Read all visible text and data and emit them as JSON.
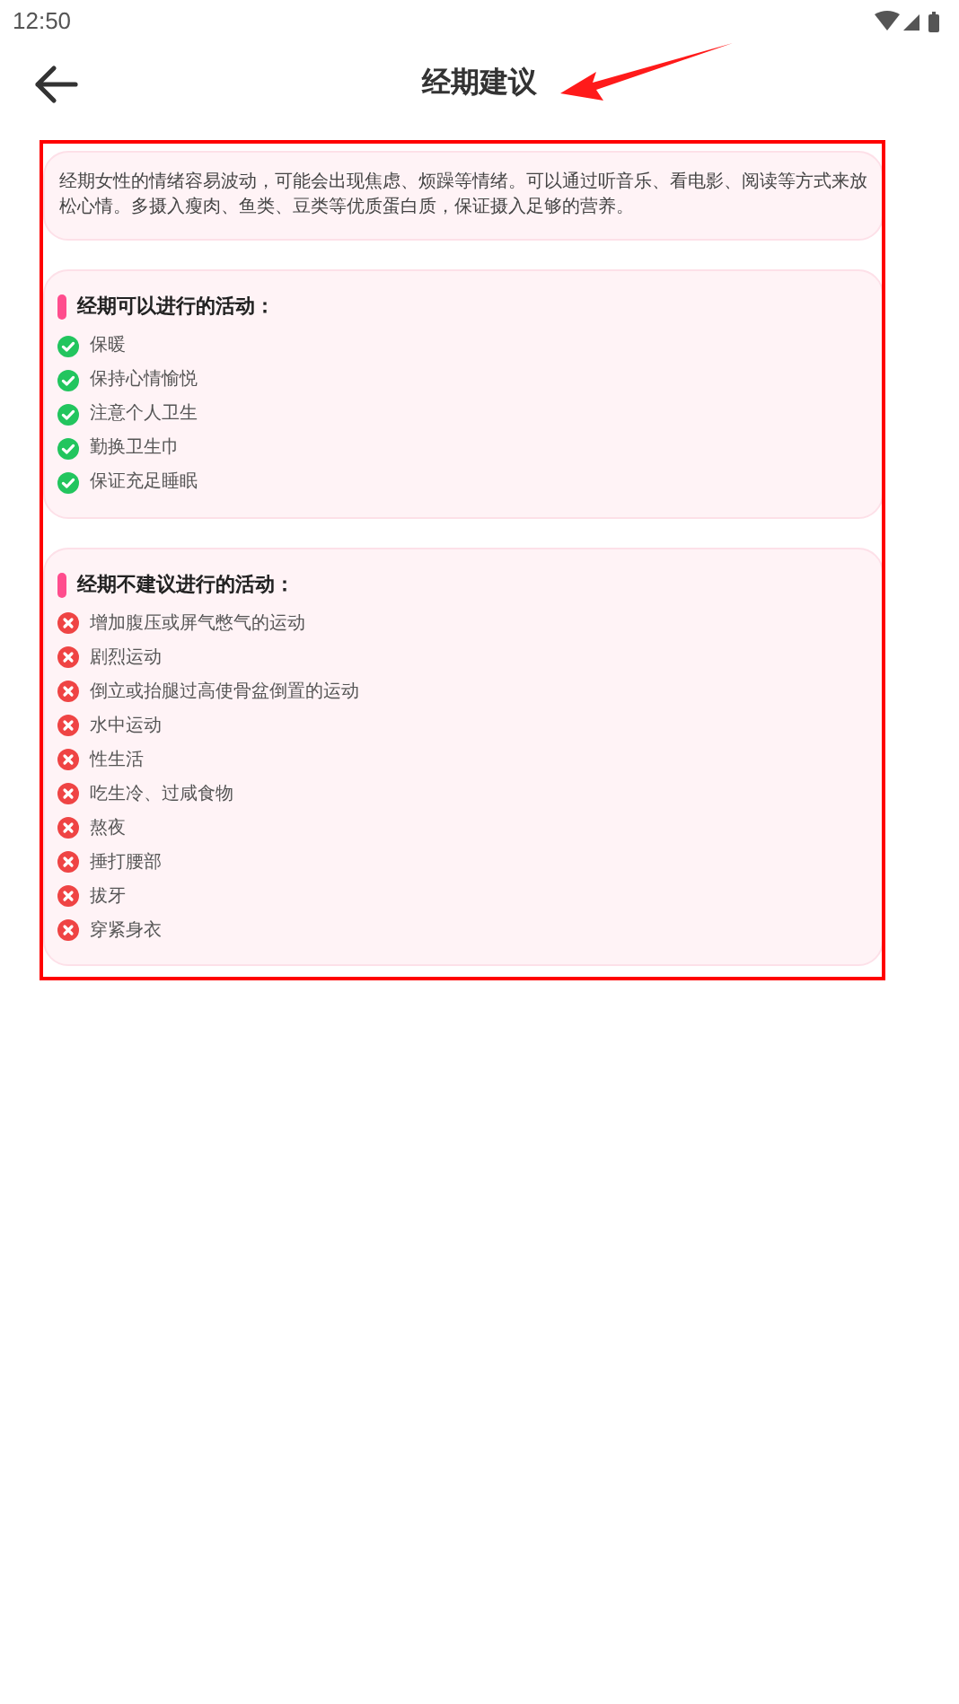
{
  "status_bar": {
    "time": "12:50"
  },
  "header": {
    "title": "经期建议"
  },
  "intro": "经期女性的情绪容易波动，可能会出现焦虑、烦躁等情绪。可以通过听音乐、看电影、阅读等方式来放松心情。多摄入瘦肉、鱼类、豆类等优质蛋白质，保证摄入足够的营养。",
  "sections": [
    {
      "title": "经期可以进行的活动：",
      "kind": "allowed",
      "items": [
        "保暖",
        "保持心情愉悦",
        "注意个人卫生",
        "勤换卫生巾",
        "保证充足睡眠"
      ]
    },
    {
      "title": "经期不建议进行的活动：",
      "kind": "avoid",
      "items": [
        "增加腹压或屏气憋气的运动",
        "剧烈运动",
        "倒立或抬腿过高使骨盆倒置的运动",
        "水中运动",
        "性生活",
        "吃生冷、过咸食物",
        "熬夜",
        "捶打腰部",
        "拔牙",
        "穿紧身衣"
      ]
    }
  ]
}
